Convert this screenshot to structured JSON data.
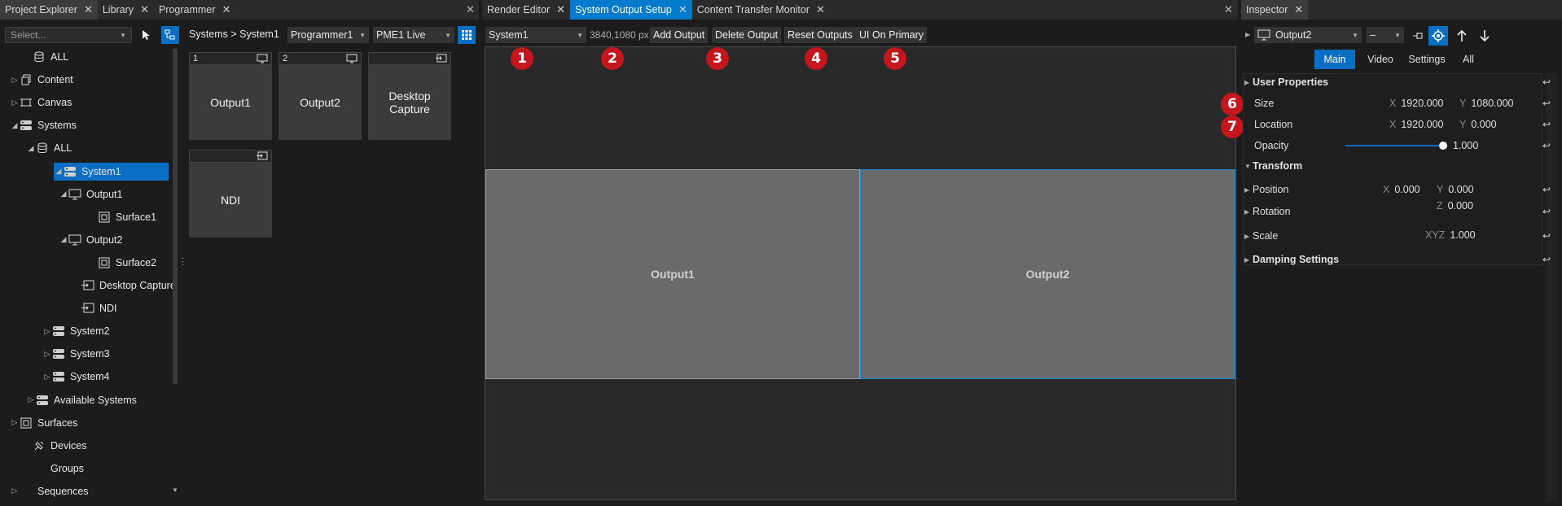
{
  "left_panel": {
    "tabs": [
      {
        "label": "Project Explorer"
      },
      {
        "label": "Library"
      },
      {
        "label": "Programmer"
      }
    ],
    "search_placeholder": "Select...",
    "breadcrumb": "Systems > System1",
    "programmer_select": "Programmer1",
    "live_select": "PME1 Live",
    "tree": [
      {
        "label": "ALL",
        "icon": "database-icon"
      },
      {
        "label": "Content",
        "icon": "content-icon"
      },
      {
        "label": "Canvas",
        "icon": "canvas-icon"
      },
      {
        "label": "Systems",
        "icon": "server-icon"
      },
      {
        "label": "ALL",
        "icon": "database-icon"
      },
      {
        "label": "System1",
        "icon": "server-icon"
      },
      {
        "label": "Output1",
        "icon": "monitor-icon"
      },
      {
        "label": "Surface1",
        "icon": "surface-icon"
      },
      {
        "label": "Output2",
        "icon": "monitor-icon"
      },
      {
        "label": "Surface2",
        "icon": "surface-icon"
      },
      {
        "label": "Desktop Capture",
        "icon": "capture-icon"
      },
      {
        "label": "NDI",
        "icon": "capture-icon"
      },
      {
        "label": "System2",
        "icon": "server-icon"
      },
      {
        "label": "System3",
        "icon": "server-icon"
      },
      {
        "label": "System4",
        "icon": "server-icon"
      },
      {
        "label": "Available Systems",
        "icon": "server-icon"
      },
      {
        "label": "Surfaces",
        "icon": "surface-icon"
      },
      {
        "label": "Devices",
        "icon": "devices-icon"
      },
      {
        "label": "Groups",
        "icon": "groups-icon"
      },
      {
        "label": "Sequences",
        "icon": "sequence-icon"
      }
    ],
    "cards": [
      {
        "num": "1",
        "label": "Output1",
        "icon": "monitor-icon"
      },
      {
        "num": "2",
        "label": "Output2",
        "icon": "monitor-icon"
      },
      {
        "num": "",
        "label": "Desktop Capture",
        "icon": "capture-icon"
      },
      {
        "num": "",
        "label": "NDI",
        "icon": "capture-icon"
      }
    ]
  },
  "center_panel": {
    "tabs": [
      {
        "label": "Render Editor"
      },
      {
        "label": "System Output Setup"
      },
      {
        "label": "Content Transfer Monitor"
      }
    ],
    "system_select": "System1",
    "resolution": "3840,1080 px",
    "buttons": {
      "add": "Add Output",
      "delete": "Delete Output",
      "reset": "Reset Outputs",
      "ui_primary": "UI On Primary"
    },
    "outputs": [
      {
        "label": "Output1"
      },
      {
        "label": "Output2"
      }
    ],
    "badges": [
      "1",
      "2",
      "3",
      "4",
      "5",
      "6",
      "7"
    ]
  },
  "inspector": {
    "tab": "Inspector",
    "object_select": "Output2",
    "mode_select": "–",
    "subtabs": [
      {
        "label": "Main"
      },
      {
        "label": "Video"
      },
      {
        "label": "Settings"
      },
      {
        "label": "All"
      }
    ],
    "sections": {
      "user_properties": "User Properties",
      "transform": "Transform",
      "damping": "Damping Settings"
    },
    "size": {
      "label": "Size",
      "x_label": "X",
      "x": "1920.000",
      "y_label": "Y",
      "y": "1080.000"
    },
    "location": {
      "label": "Location",
      "x_label": "X",
      "x": "1920.000",
      "y_label": "Y",
      "y": "0.000"
    },
    "opacity": {
      "label": "Opacity",
      "value": "1.000",
      "fraction": 1.0
    },
    "position": {
      "label": "Position",
      "x_label": "X",
      "x": "0.000",
      "y_label": "Y",
      "y": "0.000"
    },
    "rotation": {
      "label": "Rotation",
      "z_label": "Z",
      "z": "0.000"
    },
    "scale": {
      "label": "Scale",
      "xyz_label": "XYZ",
      "value": "1.000"
    }
  },
  "colors": {
    "accent": "#007acc",
    "selection": "#0a6fc2",
    "badge": "#c4161c"
  }
}
